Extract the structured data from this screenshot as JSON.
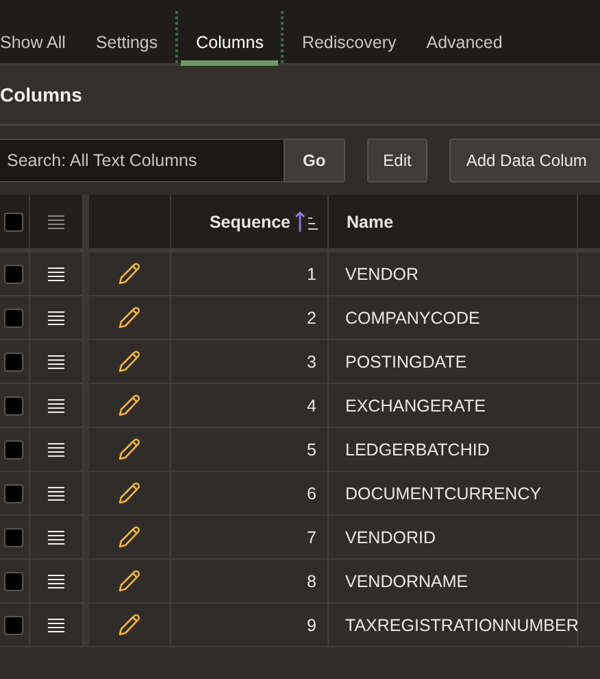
{
  "tabs": [
    {
      "label": "Show All",
      "selected": false
    },
    {
      "label": "Settings",
      "selected": false
    },
    {
      "label": "Columns",
      "selected": true
    },
    {
      "label": "Rediscovery",
      "selected": false
    },
    {
      "label": "Advanced",
      "selected": false
    }
  ],
  "region": {
    "title": "Columns"
  },
  "toolbar": {
    "search": {
      "placeholder": "Search: All Text Columns"
    },
    "buttons": [
      "Go",
      "Edit",
      "Add Data Colum"
    ]
  },
  "table": {
    "select_all": {
      "checked": false
    },
    "columns": [
      {
        "label": "Sequence",
        "sorted": true
      },
      {
        "label": "Name",
        "sorted": false
      }
    ],
    "rows": [
      {
        "checked": false,
        "sequence": "1",
        "name": "VENDOR"
      },
      {
        "checked": false,
        "sequence": "2",
        "name": "COMPANYCODE"
      },
      {
        "checked": false,
        "sequence": "3",
        "name": "POSTINGDATE"
      },
      {
        "checked": false,
        "sequence": "4",
        "name": "EXCHANGERATE"
      },
      {
        "checked": false,
        "sequence": "5",
        "name": "LEDGERBATCHID"
      },
      {
        "checked": false,
        "sequence": "6",
        "name": "DOCUMENTCURRENCY"
      },
      {
        "checked": false,
        "sequence": "7",
        "name": "VENDORID"
      },
      {
        "checked": false,
        "sequence": "8",
        "name": "VENDORNAME"
      },
      {
        "checked": false,
        "sequence": "9",
        "name": "TAXREGISTRATIONNUMBER"
      }
    ]
  }
}
